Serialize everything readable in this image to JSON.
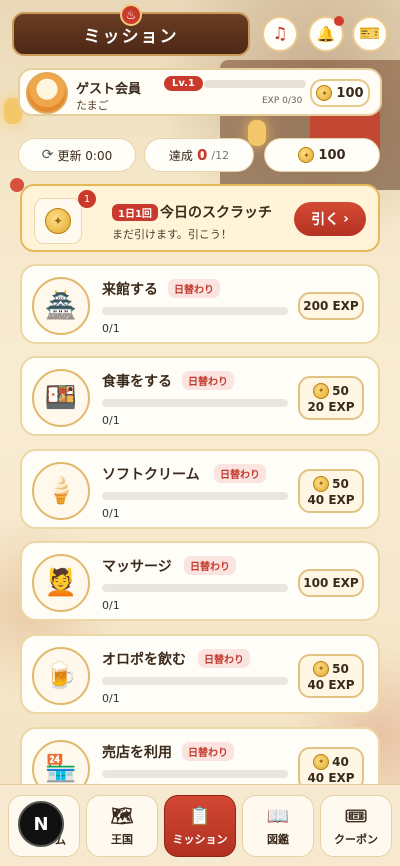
{
  "header": {
    "title": "ミッション",
    "badge_icon": "hot-spring-icon"
  },
  "top_icons": [
    {
      "name": "music-icon",
      "glyph": "♫"
    },
    {
      "name": "bell-icon",
      "glyph": "🔔"
    },
    {
      "name": "ticket-icon",
      "glyph": "🎫"
    }
  ],
  "user": {
    "name": "ゲスト会員",
    "subtitle": "たまご",
    "level": "Lv.1",
    "exp_text": "EXP 0/30",
    "exp_progress": 0,
    "coins": "100"
  },
  "stats": {
    "refresh": "更新 0:00",
    "achieved_label": "達成",
    "achieved_value": "0",
    "achieved_total": "/12",
    "coins": "100"
  },
  "scratch": {
    "count": "1",
    "tag": "1日1回",
    "title": "今日のスクラッチ",
    "subtitle": "まだ引けます。引こう！",
    "button": "引く",
    "button_arrow": "›"
  },
  "missions": [
    {
      "title": "来館する",
      "tag": "日替わり",
      "progress": "0/1",
      "coins": "",
      "exp": "200 EXP",
      "icon": "🏯"
    },
    {
      "title": "食事をする",
      "tag": "日替わり",
      "progress": "0/1",
      "coins": "50",
      "exp": "20 EXP",
      "icon": "🍱"
    },
    {
      "title": "ソフトクリーム",
      "tag": "日替わり",
      "progress": "0/1",
      "coins": "50",
      "exp": "40 EXP",
      "icon": "🍦"
    },
    {
      "title": "マッサージ",
      "tag": "日替わり",
      "progress": "0/1",
      "coins": "",
      "exp": "100 EXP",
      "icon": "💆"
    },
    {
      "title": "オロポを飲む",
      "tag": "日替わり",
      "progress": "0/1",
      "coins": "50",
      "exp": "40 EXP",
      "icon": "🍺"
    },
    {
      "title": "売店を利用",
      "tag": "日替わり",
      "progress": "",
      "coins": "40",
      "exp": "40 EXP",
      "icon": "🏪"
    }
  ],
  "nav": {
    "home_suffix": "ム",
    "items": [
      {
        "label": "王国",
        "icon": "🗺"
      },
      {
        "label": "ミッション",
        "icon": "📋"
      },
      {
        "label": "図鑑",
        "icon": "📖"
      },
      {
        "label": "クーポン",
        "icon": "🎟"
      }
    ],
    "avatar_letter": "N"
  },
  "colors": {
    "accent": "#c93a2c",
    "gold": "#e0a72b",
    "cream": "#fffdf7"
  }
}
